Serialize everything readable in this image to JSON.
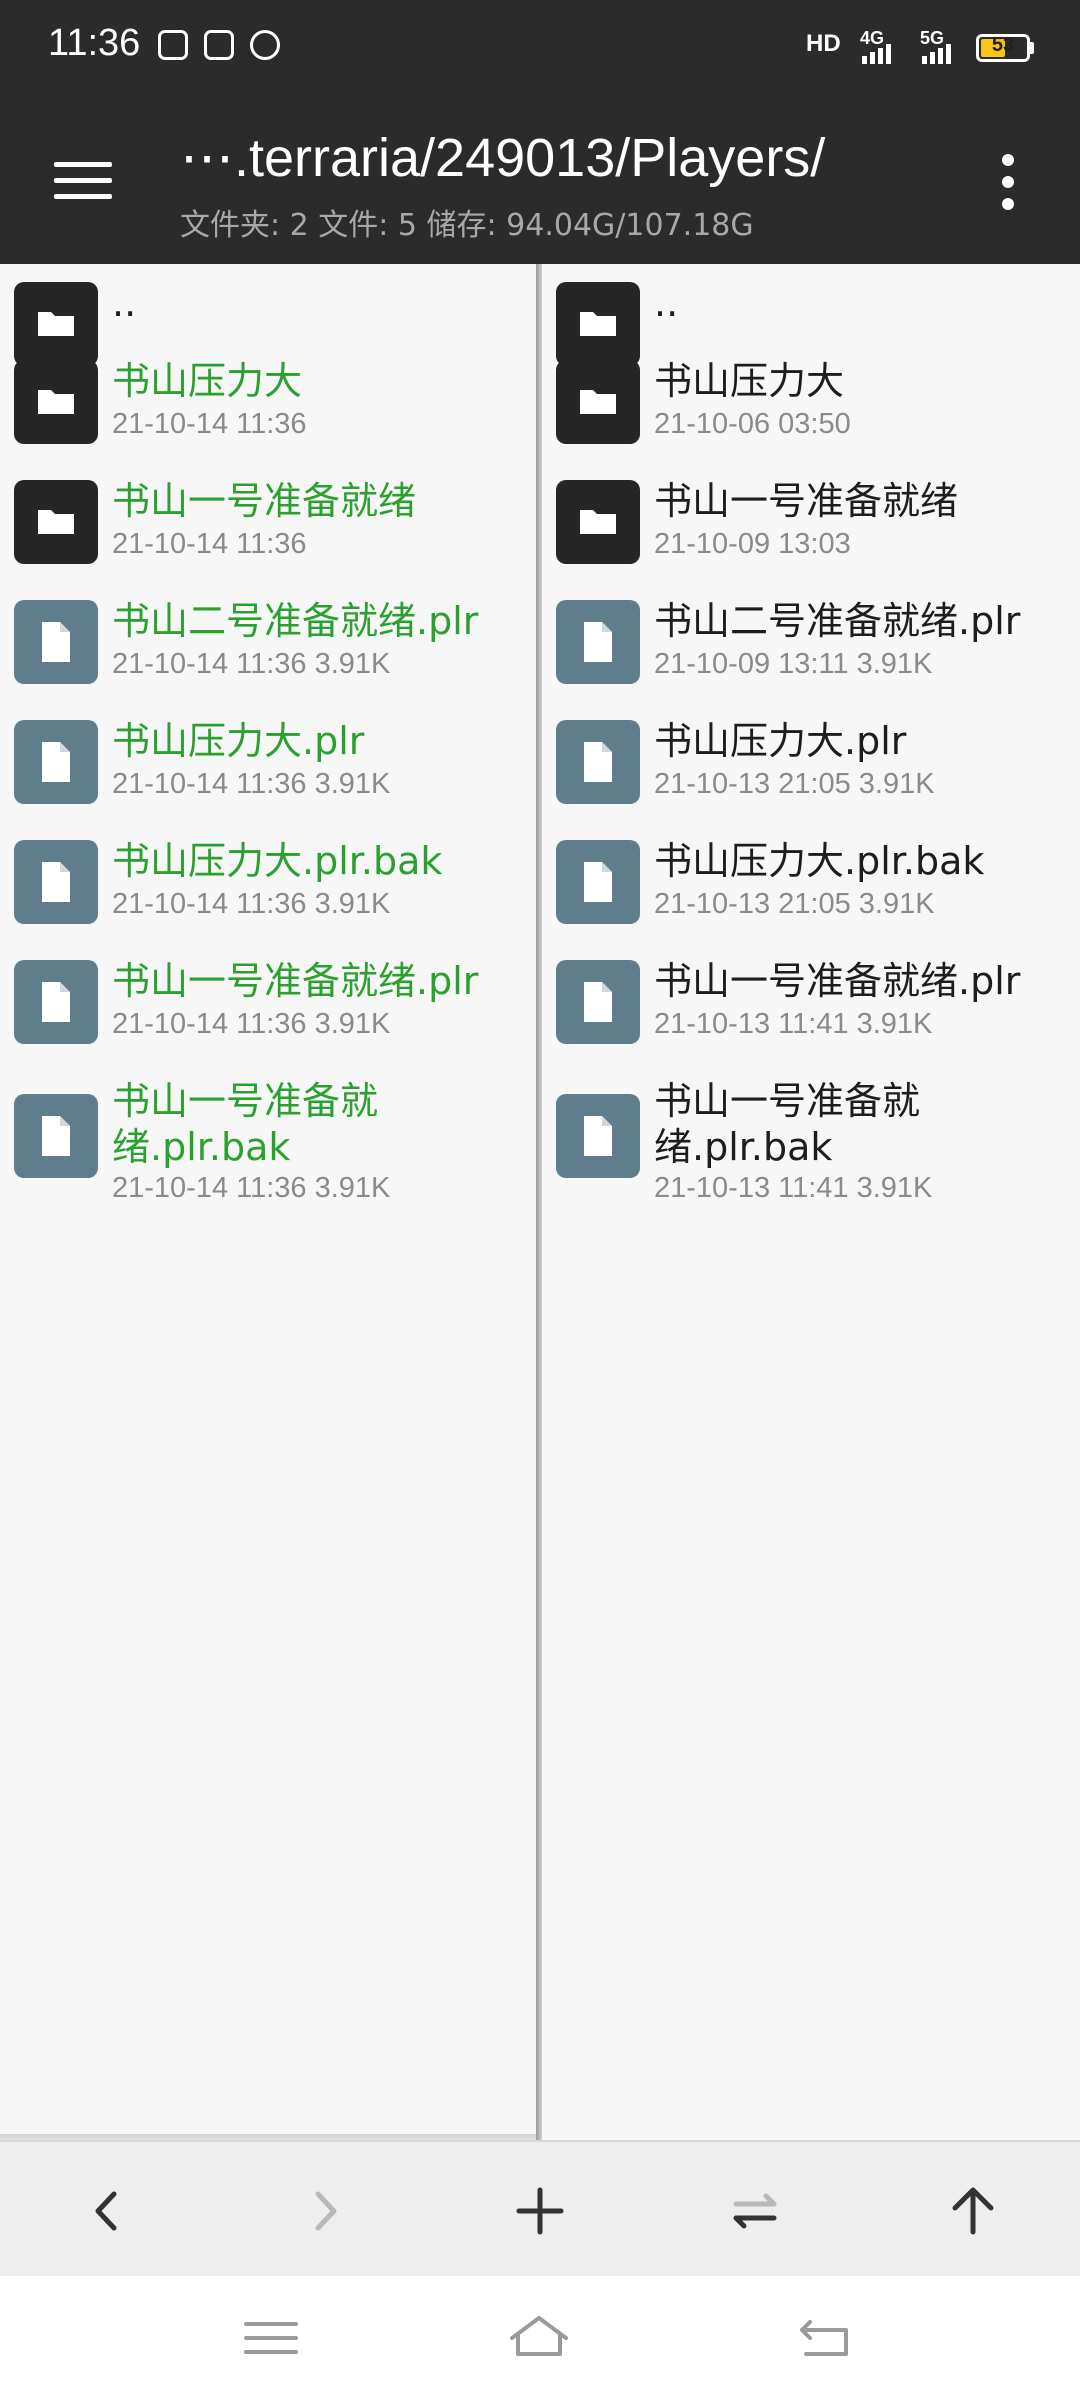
{
  "status_bar": {
    "time": "11:36",
    "network_hd": "HD",
    "net1": "4G",
    "net2": "5G",
    "battery": "53"
  },
  "app_bar": {
    "path": "⋯.terraria/249013/Players/",
    "summary": "文件夹: 2  文件: 5  储存: 94.04G/107.18G"
  },
  "left_pane": {
    "items": [
      {
        "type": "folder",
        "name": "..",
        "meta": ""
      },
      {
        "type": "folder",
        "name": "书山压力大",
        "meta": "21-10-14 11:36"
      },
      {
        "type": "folder",
        "name": "书山一号准备就绪",
        "meta": "21-10-14 11:36"
      },
      {
        "type": "file",
        "name": "书山二号准备就绪.plr",
        "meta": "21-10-14 11:36  3.91K"
      },
      {
        "type": "file",
        "name": "书山压力大.plr",
        "meta": "21-10-14 11:36  3.91K"
      },
      {
        "type": "file",
        "name": "书山压力大.plr.bak",
        "meta": "21-10-14 11:36  3.91K"
      },
      {
        "type": "file",
        "name": "书山一号准备就绪.plr",
        "meta": "21-10-14 11:36  3.91K"
      },
      {
        "type": "file",
        "name": "书山一号准备就绪.plr.bak",
        "meta": "21-10-14 11:36  3.91K"
      }
    ]
  },
  "right_pane": {
    "items": [
      {
        "type": "folder",
        "name": "..",
        "meta": ""
      },
      {
        "type": "folder",
        "name": "书山压力大",
        "meta": "21-10-06 03:50"
      },
      {
        "type": "folder",
        "name": "书山一号准备就绪",
        "meta": "21-10-09 13:03"
      },
      {
        "type": "file",
        "name": "书山二号准备就绪.plr",
        "meta": "21-10-09 13:11  3.91K"
      },
      {
        "type": "file",
        "name": "书山压力大.plr",
        "meta": "21-10-13 21:05  3.91K"
      },
      {
        "type": "file",
        "name": "书山压力大.plr.bak",
        "meta": "21-10-13 21:05  3.91K"
      },
      {
        "type": "file",
        "name": "书山一号准备就绪.plr",
        "meta": "21-10-13 11:41  3.91K"
      },
      {
        "type": "file",
        "name": "书山一号准备就绪.plr.bak",
        "meta": "21-10-13 11:41  3.91K"
      }
    ]
  },
  "toolbar": {
    "buttons": [
      "back-icon",
      "forward-icon",
      "add-icon",
      "swap-icon",
      "up-icon"
    ]
  },
  "navbar": {
    "buttons": [
      "menu-icon",
      "home-icon",
      "back-icon"
    ]
  },
  "colors": {
    "bar": "#2b2b2b",
    "highlight_text": "#2aa12f",
    "folder_icon": "#262626",
    "file_icon": "#607d8b"
  }
}
